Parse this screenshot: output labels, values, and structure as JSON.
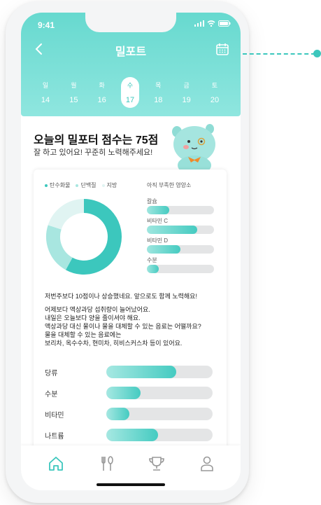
{
  "status": {
    "time": "9:41"
  },
  "header": {
    "title": "밀포트"
  },
  "week": [
    {
      "name": "일",
      "date": "14",
      "active": false
    },
    {
      "name": "월",
      "date": "15",
      "active": false
    },
    {
      "name": "화",
      "date": "16",
      "active": false
    },
    {
      "name": "수",
      "date": "17",
      "active": true
    },
    {
      "name": "목",
      "date": "18",
      "active": false
    },
    {
      "name": "금",
      "date": "19",
      "active": false
    },
    {
      "name": "토",
      "date": "20",
      "active": false
    }
  ],
  "score": {
    "title": "오늘의 밀포터 점수는 75점",
    "subtitle": "잘 하고 있어요! 꾸준히 노력해주세요!"
  },
  "legend": [
    {
      "label": "탄수화물",
      "color": "#3cc7bd"
    },
    {
      "label": "단백질",
      "color": "#a8e6e0"
    },
    {
      "label": "지방",
      "color": "#e0f4f2"
    }
  ],
  "donut_data": [
    {
      "label": "탄수화물",
      "value": 0.58
    },
    {
      "label": "단백질",
      "value": 0.22
    },
    {
      "label": "지방",
      "value": 0.2
    }
  ],
  "lacking": {
    "title": "아직 부족한 영양소",
    "items": [
      {
        "label": "칼슘",
        "value": 0.33
      },
      {
        "label": "비타민 C",
        "value": 0.75
      },
      {
        "label": "비타민 D",
        "value": 0.5
      },
      {
        "label": "수분",
        "value": 0.18
      }
    ]
  },
  "messages": {
    "summary": "저번주보다 10점이나 상승했네요. 앞으로도 함께 노력해요!",
    "advice": [
      "어제보다 액상과당 섭취량이 늘어났어요.",
      "내일은 오늘보다 양을 줄이셔야 해요.",
      "액상과당 대신 물이나 물을 대체할 수 있는 음료는 어떨까요?",
      "물을 대체할 수 있는 음료에는",
      "보리차, 옥수수차, 현미차, 히비스커스차 등이 있어요."
    ]
  },
  "metrics": [
    {
      "label": "당류",
      "value": 0.66
    },
    {
      "label": "수분",
      "value": 0.32
    },
    {
      "label": "비타민",
      "value": 0.22
    },
    {
      "label": "나트륨",
      "value": 0.49
    }
  ],
  "tabs": [
    {
      "name": "home-icon",
      "active": true
    },
    {
      "name": "fork-spoon-icon",
      "active": false
    },
    {
      "name": "trophy-icon",
      "active": false
    },
    {
      "name": "person-icon",
      "active": false
    }
  ],
  "colors": {
    "accent": "#3cc7bd",
    "accent_light": "#a8e6e0",
    "header_bg": "#67d9cf"
  }
}
